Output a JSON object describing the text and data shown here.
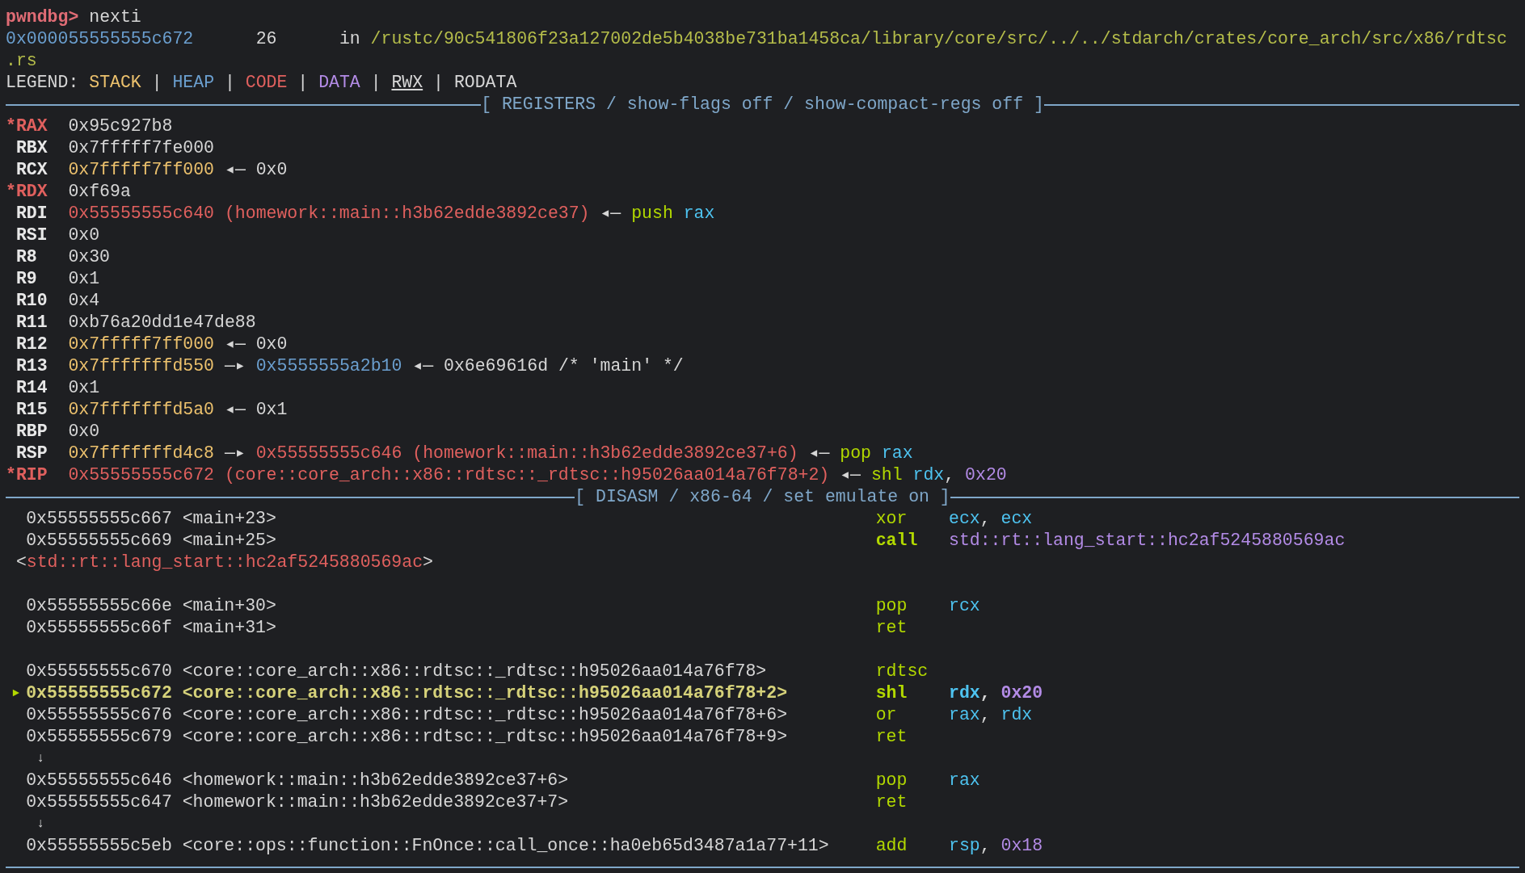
{
  "prompt": {
    "prompt": "pwndbg>",
    "command": "nexti"
  },
  "location": {
    "address": "0x000055555555c672",
    "line": "26",
    "in": "in",
    "path": "/rustc/90c541806f23a127002de5b4038be731ba1458ca/library/core/src/../../stdarch/crates/core_arch/src/x86/rdtsc",
    "path_wrap": ".rs"
  },
  "legend": {
    "label": "LEGEND:",
    "separator": "|",
    "items": [
      {
        "text": "STACK",
        "kind": "stack"
      },
      {
        "text": "HEAP",
        "kind": "heap"
      },
      {
        "text": "CODE",
        "kind": "code"
      },
      {
        "text": "DATA",
        "kind": "data"
      },
      {
        "text": "RWX",
        "kind": "rwx"
      },
      {
        "text": "RODATA",
        "kind": "plain"
      }
    ]
  },
  "registers": {
    "title": "[ REGISTERS / show-flags off / show-compact-regs off ]",
    "changed_marker": "*",
    "items": [
      {
        "name": "RAX",
        "changed": true,
        "chain": [
          {
            "text": "0x95c927b8",
            "kind": "plain"
          }
        ]
      },
      {
        "name": "RBX",
        "changed": false,
        "chain": [
          {
            "text": "0x7fffff7fe000",
            "kind": "plain"
          }
        ]
      },
      {
        "name": "RCX",
        "changed": false,
        "chain": [
          {
            "text": "0x7fffff7ff000",
            "kind": "stack"
          },
          {
            "text": "◂—",
            "kind": "arrow"
          },
          {
            "text": "0x0",
            "kind": "plain"
          }
        ]
      },
      {
        "name": "RDX",
        "changed": true,
        "chain": [
          {
            "text": "0xf69a",
            "kind": "plain"
          }
        ]
      },
      {
        "name": "RDI",
        "changed": false,
        "chain": [
          {
            "text": "0x55555555c640 (homework::main::h3b62edde3892ce37)",
            "kind": "code"
          },
          {
            "text": "◂—",
            "kind": "arrow"
          },
          {
            "text": "push",
            "kind": "mnemonic"
          },
          {
            "text": "rax",
            "kind": "register"
          }
        ]
      },
      {
        "name": "RSI",
        "changed": false,
        "chain": [
          {
            "text": "0x0",
            "kind": "plain"
          }
        ]
      },
      {
        "name": "R8",
        "changed": false,
        "chain": [
          {
            "text": "0x30",
            "kind": "plain"
          }
        ]
      },
      {
        "name": "R9",
        "changed": false,
        "chain": [
          {
            "text": "0x1",
            "kind": "plain"
          }
        ]
      },
      {
        "name": "R10",
        "changed": false,
        "chain": [
          {
            "text": "0x4",
            "kind": "plain"
          }
        ]
      },
      {
        "name": "R11",
        "changed": false,
        "chain": [
          {
            "text": "0xb76a20dd1e47de88",
            "kind": "plain"
          }
        ]
      },
      {
        "name": "R12",
        "changed": false,
        "chain": [
          {
            "text": "0x7fffff7ff000",
            "kind": "stack"
          },
          {
            "text": "◂—",
            "kind": "arrow"
          },
          {
            "text": "0x0",
            "kind": "plain"
          }
        ]
      },
      {
        "name": "R13",
        "changed": false,
        "chain": [
          {
            "text": "0x7fffffffd550",
            "kind": "stack"
          },
          {
            "text": "—▸",
            "kind": "arrow"
          },
          {
            "text": "0x5555555a2b10",
            "kind": "heap"
          },
          {
            "text": "◂—",
            "kind": "arrow"
          },
          {
            "text": "0x6e69616d /* 'main' */",
            "kind": "plain"
          }
        ]
      },
      {
        "name": "R14",
        "changed": false,
        "chain": [
          {
            "text": "0x1",
            "kind": "plain"
          }
        ]
      },
      {
        "name": "R15",
        "changed": false,
        "chain": [
          {
            "text": "0x7fffffffd5a0",
            "kind": "stack"
          },
          {
            "text": "◂—",
            "kind": "arrow"
          },
          {
            "text": "0x1",
            "kind": "plain"
          }
        ]
      },
      {
        "name": "RBP",
        "changed": false,
        "chain": [
          {
            "text": "0x0",
            "kind": "plain"
          }
        ]
      },
      {
        "name": "RSP",
        "changed": false,
        "chain": [
          {
            "text": "0x7fffffffd4c8",
            "kind": "stack"
          },
          {
            "text": "—▸",
            "kind": "arrow"
          },
          {
            "text": "0x55555555c646 (homework::main::h3b62edde3892ce37+6)",
            "kind": "code"
          },
          {
            "text": "◂—",
            "kind": "arrow"
          },
          {
            "text": "pop",
            "kind": "mnemonic"
          },
          {
            "text": "rax",
            "kind": "register"
          }
        ]
      },
      {
        "name": "RIP",
        "changed": true,
        "chain": [
          {
            "text": "0x55555555c672 (core::core_arch::x86::rdtsc::_rdtsc::h95026aa014a76f78+2)",
            "kind": "code"
          },
          {
            "text": "◂—",
            "kind": "arrow"
          },
          {
            "text": "shl",
            "kind": "mnemonic"
          },
          {
            "text": "rdx",
            "kind": "register"
          },
          {
            "text": ",",
            "kind": "punct"
          },
          {
            "text": "0x20",
            "kind": "number"
          }
        ]
      }
    ]
  },
  "disasm": {
    "title": "[ DISASM / x86-64 / set emulate on ]",
    "current_marker": "►",
    "rows": [
      {
        "kind": "instruction",
        "current": false,
        "address": "0x55555555c667",
        "symbol": "<main+23>",
        "mnemonic": "xor",
        "operands": [
          {
            "text": "ecx",
            "kind": "register"
          },
          {
            "text": ",",
            "kind": "punct"
          },
          {
            "text": "ecx",
            "kind": "register"
          }
        ]
      },
      {
        "kind": "instruction",
        "current": false,
        "address": "0x55555555c669",
        "symbol": "<main+25>",
        "mnemonic": "call",
        "mnemonic_bold": true,
        "operands": [
          {
            "text": "std::rt::lang_start::hc2af5245880569ac",
            "kind": "data"
          }
        ]
      },
      {
        "kind": "continuation",
        "parts": [
          {
            "text": "<",
            "kind": "plain"
          },
          {
            "text": "std::rt::lang_start::hc2af5245880569ac",
            "kind": "code"
          },
          {
            "text": ">",
            "kind": "plain"
          }
        ]
      },
      {
        "kind": "blank"
      },
      {
        "kind": "instruction",
        "current": false,
        "address": "0x55555555c66e",
        "symbol": "<main+30>",
        "mnemonic": "pop",
        "operands": [
          {
            "text": "rcx",
            "kind": "register"
          }
        ]
      },
      {
        "kind": "instruction",
        "current": false,
        "address": "0x55555555c66f",
        "symbol": "<main+31>",
        "mnemonic": "ret",
        "operands": []
      },
      {
        "kind": "blank"
      },
      {
        "kind": "instruction",
        "current": false,
        "address": "0x55555555c670",
        "symbol": "<core::core_arch::x86::rdtsc::_rdtsc::h95026aa014a76f78>",
        "mnemonic": "rdtsc",
        "operands": []
      },
      {
        "kind": "instruction",
        "current": true,
        "address": "0x55555555c672",
        "symbol": "<core::core_arch::x86::rdtsc::_rdtsc::h95026aa014a76f78+2>",
        "mnemonic": "shl",
        "operands": [
          {
            "text": "rdx",
            "kind": "register"
          },
          {
            "text": ",",
            "kind": "punct"
          },
          {
            "text": "0x20",
            "kind": "number"
          }
        ]
      },
      {
        "kind": "instruction",
        "current": false,
        "address": "0x55555555c676",
        "symbol": "<core::core_arch::x86::rdtsc::_rdtsc::h95026aa014a76f78+6>",
        "mnemonic": "or",
        "operands": [
          {
            "text": "rax",
            "kind": "register"
          },
          {
            "text": ",",
            "kind": "punct"
          },
          {
            "text": "rdx",
            "kind": "register"
          }
        ]
      },
      {
        "kind": "instruction",
        "current": false,
        "address": "0x55555555c679",
        "symbol": "<core::core_arch::x86::rdtsc::_rdtsc::h95026aa014a76f78+9>",
        "mnemonic": "ret",
        "operands": []
      },
      {
        "kind": "jump",
        "text": "↓"
      },
      {
        "kind": "instruction",
        "current": false,
        "address": "0x55555555c646",
        "symbol": "<homework::main::h3b62edde3892ce37+6>",
        "mnemonic": "pop",
        "operands": [
          {
            "text": "rax",
            "kind": "register"
          }
        ]
      },
      {
        "kind": "instruction",
        "current": false,
        "address": "0x55555555c647",
        "symbol": "<homework::main::h3b62edde3892ce37+7>",
        "mnemonic": "ret",
        "operands": []
      },
      {
        "kind": "jump",
        "text": "↓"
      },
      {
        "kind": "instruction",
        "current": false,
        "address": "0x55555555c5eb",
        "symbol": "<core::ops::function::FnOnce::call_once::ha0eb65d3487a1a77+11>",
        "mnemonic": "add",
        "operands": [
          {
            "text": "rsp",
            "kind": "register"
          },
          {
            "text": ",",
            "kind": "punct"
          },
          {
            "text": "0x18",
            "kind": "number"
          }
        ]
      }
    ]
  }
}
